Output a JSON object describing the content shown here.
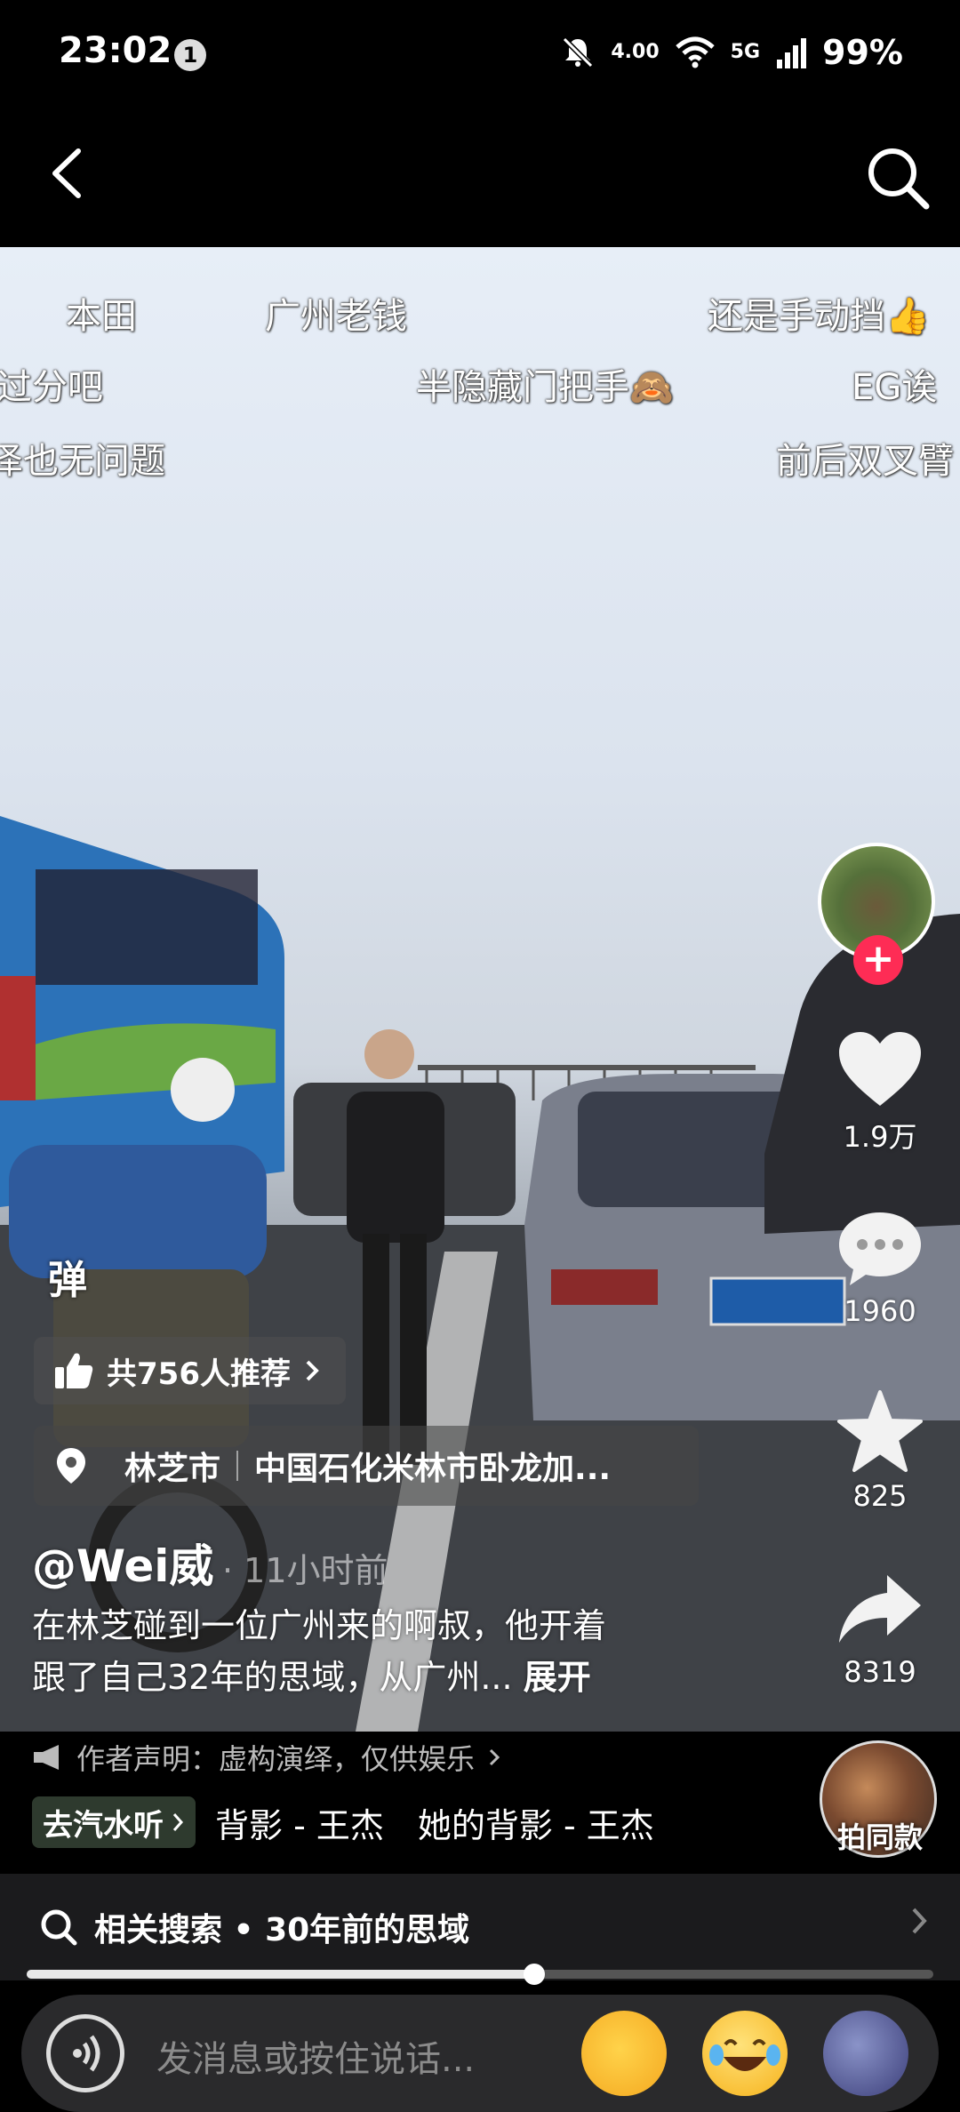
{
  "status_bar": {
    "time": "23:02",
    "notification_count": "1",
    "speed": "4.00",
    "network": "5G",
    "battery": "99%"
  },
  "nav": {
    "back_icon": "chevron-left-icon",
    "search_icon": "search-icon"
  },
  "danmaku": [
    "本田",
    "广州老钱",
    "还是手动挡👍",
    "过分吧",
    "半隐藏门把手🙈",
    "EG诶",
    "泽也无问题",
    "前后双叉臂"
  ],
  "actions": {
    "likes": "1.9万",
    "comments": "1960",
    "favorites": "825",
    "shares": "8319"
  },
  "overlay": {
    "watermark": "弹",
    "recommend": "共756人推荐",
    "location_city": "林芝市",
    "location_place": "中国石化米林市卧龙加...",
    "author": "@Wei威",
    "time_ago": "· 11小时前",
    "description_line1": "在林芝碰到一位广州来的啊叔，他开着",
    "description_line2": "跟了自己32年的思域，从广州...",
    "expand": "展开"
  },
  "bottom": {
    "declaration": "作者声明：虚构演绎，仅供娱乐",
    "music_chip": "去汽水听",
    "music_text": "背影 - 王杰　她的背影 - 王杰",
    "same_style": "拍同款",
    "related_search": "相关搜索 • 30年前的思域",
    "progress": 0.56,
    "input_placeholder": "发消息或按住说话..."
  },
  "colors": {
    "accent": "#fe2c55",
    "background": "#000000"
  }
}
